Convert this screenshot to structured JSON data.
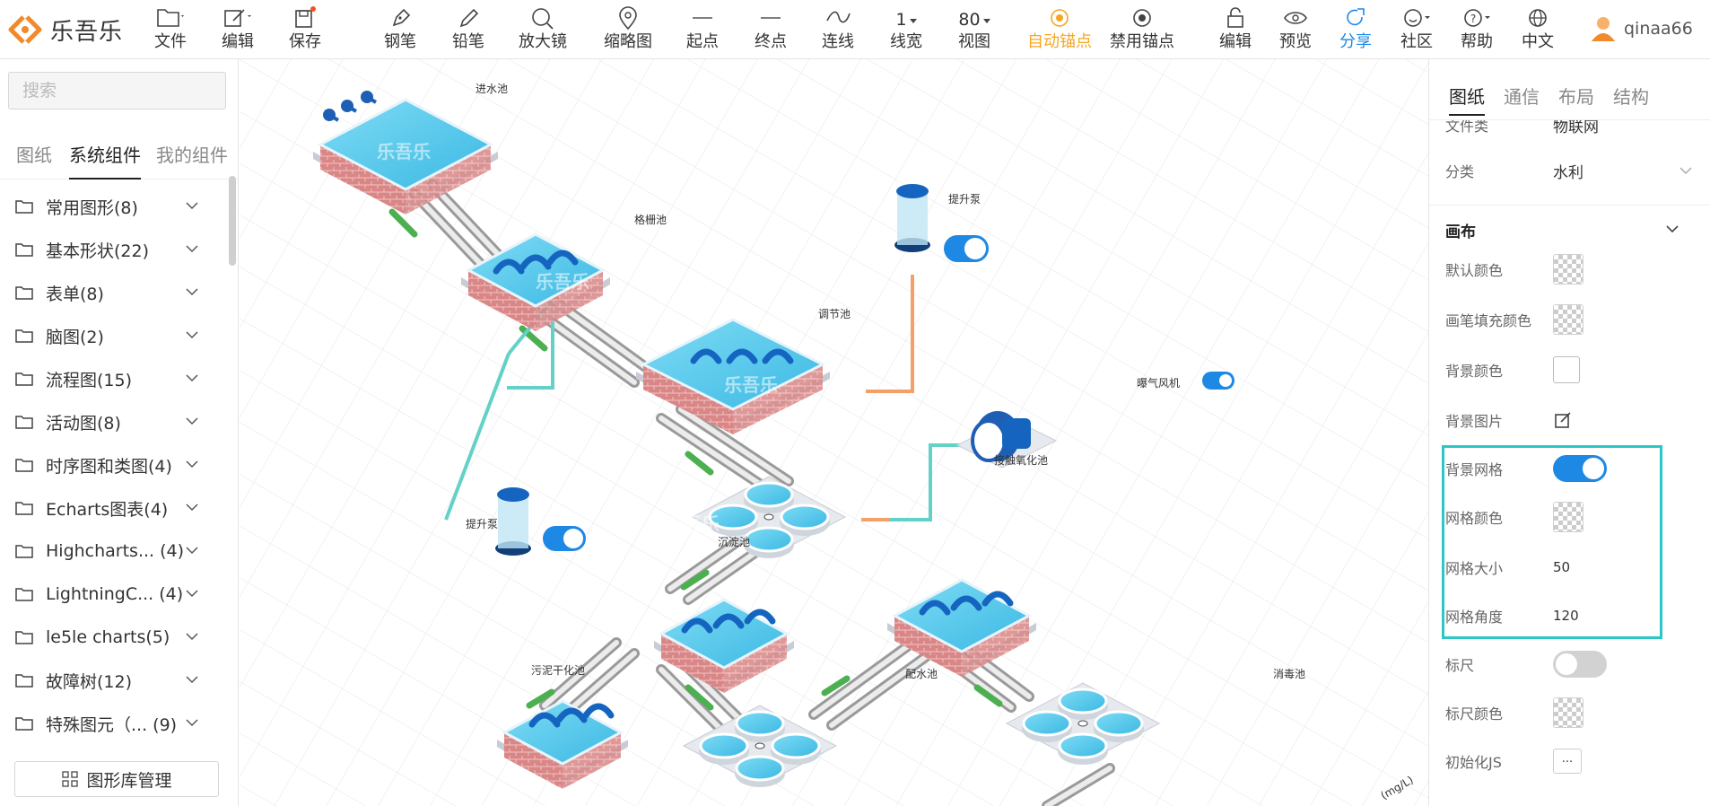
{
  "app": {
    "title": "乐吾乐"
  },
  "toolbar": {
    "file": "文件",
    "edit": "编辑",
    "save": "保存",
    "pen": "钢笔",
    "pencil": "铅笔",
    "magnifier": "放大镜",
    "thumbnail": "缩略图",
    "start": "起点",
    "end": "终点",
    "line": "连线",
    "line_width_value": "1",
    "line_width": "线宽",
    "view_value": "80",
    "view": "视图",
    "auto_anchor": "自动锚点",
    "disable_anchor": "禁用锚点",
    "edit2": "编辑",
    "preview": "预览",
    "share": "分享",
    "community": "社区",
    "help": "帮助",
    "language": "中文",
    "username": "qinaa66"
  },
  "left": {
    "search_placeholder": "搜索",
    "tabs": [
      "图纸",
      "系统组件",
      "我的组件"
    ],
    "items": [
      "常用图形(8)",
      "基本形状(22)",
      "表单(8)",
      "脑图(2)",
      "流程图(15)",
      "活动图(8)",
      "时序图和类图(4)",
      "Echarts图表(4)",
      "Highcharts... (4)",
      "LightningC... (4)",
      "le5le charts(5)",
      "故障树(12)",
      "特殊图元（... (9)"
    ],
    "manage": "图形库管理"
  },
  "canvas": {
    "labels": {
      "inlet": "进水池",
      "grid": "格栅池",
      "adjust": "调节池",
      "pump1": "提升泵",
      "pump2": "提升泵",
      "blower": "曝气风机",
      "contact": "接触氧化池",
      "settle": "沉淀池",
      "sludge": "污泥干化池",
      "distribute": "配水池",
      "disinfect": "消毒池",
      "watermark": "乐吾乐",
      "corner_unit": "(mg/L)"
    }
  },
  "right": {
    "tabs": [
      "图纸",
      "通信",
      "布局",
      "结构"
    ],
    "file_type_label": "文件类",
    "file_type_value": "物联网",
    "category_label": "分类",
    "category_value": "水利",
    "canvas_section": "画布",
    "default_color": "默认颜色",
    "pen_fill_color": "画笔填充颜色",
    "background_color": "背景颜色",
    "background_image": "背景图片",
    "background_grid": "背景网格",
    "grid_color": "网格颜色",
    "grid_size_label": "网格大小",
    "grid_size_value": "50",
    "grid_angle_label": "网格角度",
    "grid_angle_value": "120",
    "ruler": "标尺",
    "ruler_color": "标尺颜色",
    "init_js": "初始化JS",
    "init_js_btn": "..."
  },
  "colors": {
    "accent": "#1e88e5",
    "active": "#f5a623",
    "highlight": "#2bc6c6",
    "logo": "#f08a2c"
  }
}
